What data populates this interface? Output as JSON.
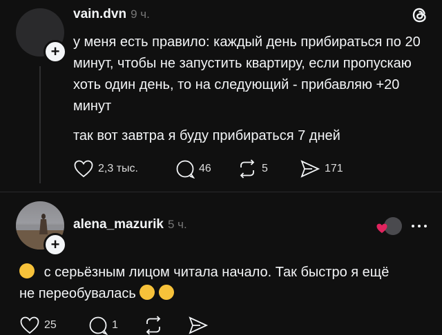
{
  "post1": {
    "username": "vain.dvn",
    "time": "9 ч.",
    "text": "у меня есть правило: каждый день прибираться по 20 минут, чтобы не запустить квартиру, если пропускаю хоть один день, то на следующий - прибавляю +20 минут",
    "text2": "так вот завтра я буду прибираться 7 дней",
    "likes": "2,3 тыс.",
    "comments": "46",
    "reposts": "5",
    "shares": "171"
  },
  "post2": {
    "username": "alena_mazurik",
    "time": "5 ч.",
    "text_a": "с серьёзным лицом читала начало. Так быстро я ещё",
    "text_b": "не переобувалась",
    "likes": "25",
    "comments": "1"
  },
  "icons": {
    "logo": "threads-logo-icon",
    "like": "heart-icon",
    "comment": "comment-icon",
    "repost": "repost-icon",
    "share": "share-icon",
    "more": "more-icon"
  },
  "colors": {
    "background": "#101010",
    "text": "#f3f5f7",
    "muted": "#777777",
    "like_red": "#e0245e"
  }
}
